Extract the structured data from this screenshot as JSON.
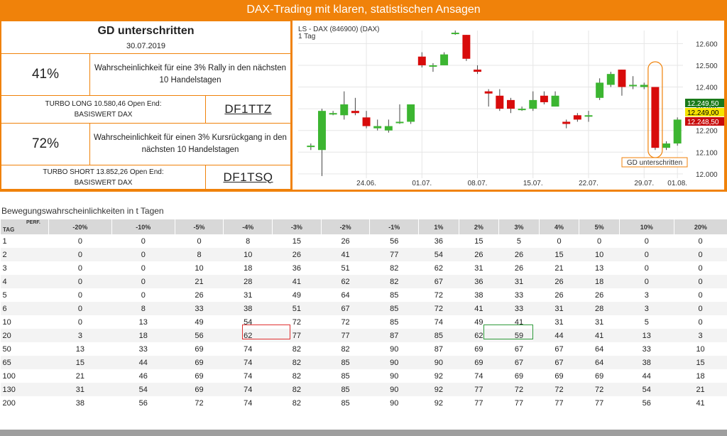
{
  "banner": "DAX-Trading mit klaren, statistischen Ansagen",
  "signal": {
    "title": "GD unterschritten",
    "date": "30.07.2019"
  },
  "long": {
    "pct": "41%",
    "desc": "Wahrscheinlichkeit für eine 3% Rally in den nächsten 10 Handelstagen",
    "product_line1": "TURBO LONG 10.580,46 Open End:",
    "product_line2": "BASISWERT DAX",
    "code": "DF1TTZ"
  },
  "short": {
    "pct": "72%",
    "desc": "Wahrscheinlichkeit für einen 3% Kursrückgang in den nächsten 10 Handelstagen",
    "product_line1": "TURBO SHORT 13.852,26 Open End:",
    "product_line2": "BASISWERT DAX",
    "code": "DF1TSQ"
  },
  "chart": {
    "title_line1": "LS - DAX (846900) (DAX)",
    "title_line2": "1 Tag",
    "annotation": "GD unterschritten",
    "y_ticks": [
      "12.600",
      "12.500",
      "12.400",
      "12.300",
      "12.200",
      "12.100",
      "12.000"
    ],
    "x_ticks": [
      "24.06.",
      "01.07.",
      "08.07.",
      "15.07.",
      "22.07.",
      "29.07.",
      "01.08."
    ],
    "price_labels": [
      "12.249,50",
      "12.249,00",
      "12.248,50"
    ],
    "colors": {
      "up": "#3cb531",
      "down": "#d80b0b",
      "accent": "#f0820a"
    }
  },
  "chart_data": {
    "type": "candlestick",
    "x": [
      "20.06.",
      "21.06.",
      "24.06.",
      "25.06.",
      "26.06.",
      "27.06.",
      "28.06.",
      "01.07.",
      "02.07.",
      "03.07.",
      "04.07.",
      "05.07.",
      "08.07.",
      "09.07.",
      "10.07.",
      "11.07.",
      "12.07.",
      "15.07.",
      "16.07.",
      "17.07.",
      "18.07.",
      "19.07.",
      "22.07.",
      "23.07.",
      "24.07.",
      "25.07.",
      "26.07.",
      "29.07.",
      "30.07.",
      "31.07.",
      "01.08."
    ],
    "ylim": [
      11980,
      12660
    ],
    "candles": [
      {
        "open": 12130,
        "close": 12130,
        "high": 12140,
        "low": 12110
      },
      {
        "open": 12110,
        "close": 12290,
        "high": 12300,
        "low": 11990
      },
      {
        "open": 12280,
        "close": 12280,
        "high": 12290,
        "low": 12270
      },
      {
        "open": 12270,
        "close": 12320,
        "high": 12380,
        "low": 12250
      },
      {
        "open": 12290,
        "close": 12280,
        "high": 12350,
        "low": 12270
      },
      {
        "open": 12260,
        "close": 12220,
        "high": 12290,
        "low": 12210
      },
      {
        "open": 12210,
        "close": 12220,
        "high": 12250,
        "low": 12200
      },
      {
        "open": 12200,
        "close": 12220,
        "high": 12250,
        "low": 12190
      },
      {
        "open": 12240,
        "close": 12240,
        "high": 12320,
        "low": 12230
      },
      {
        "open": 12240,
        "close": 12320,
        "high": 12320,
        "low": 12230
      },
      {
        "open": 12540,
        "close": 12500,
        "high": 12560,
        "low": 12490
      },
      {
        "open": 12500,
        "close": 12500,
        "high": 12510,
        "low": 12470
      },
      {
        "open": 12500,
        "close": 12550,
        "high": 12560,
        "low": 12500
      },
      {
        "open": 12650,
        "close": 12650,
        "high": 12660,
        "low": 12640
      },
      {
        "open": 12640,
        "close": 12530,
        "high": 12640,
        "low": 12520
      },
      {
        "open": 12480,
        "close": 12470,
        "high": 12500,
        "low": 12460
      },
      {
        "open": 12380,
        "close": 12370,
        "high": 12390,
        "low": 12310
      },
      {
        "open": 12360,
        "close": 12300,
        "high": 12390,
        "low": 12290
      },
      {
        "open": 12340,
        "close": 12300,
        "high": 12350,
        "low": 12280
      },
      {
        "open": 12300,
        "close": 12300,
        "high": 12310,
        "low": 12290
      },
      {
        "open": 12300,
        "close": 12340,
        "high": 12380,
        "low": 12290
      },
      {
        "open": 12360,
        "close": 12330,
        "high": 12380,
        "low": 12320
      },
      {
        "open": 12310,
        "close": 12360,
        "high": 12380,
        "low": 12310
      },
      {
        "open": 12240,
        "close": 12230,
        "high": 12250,
        "low": 12210
      },
      {
        "open": 12270,
        "close": 12250,
        "high": 12280,
        "low": 12240
      },
      {
        "open": 12270,
        "close": 12270,
        "high": 12290,
        "low": 12240
      },
      {
        "open": 12350,
        "close": 12420,
        "high": 12440,
        "low": 12340
      },
      {
        "open": 12410,
        "close": 12460,
        "high": 12470,
        "low": 12400
      },
      {
        "open": 12480,
        "close": 12400,
        "high": 12480,
        "low": 12360
      },
      {
        "open": 12410,
        "close": 12410,
        "high": 12450,
        "low": 12390
      },
      {
        "open": 12400,
        "close": 12410,
        "high": 12420,
        "low": 12390
      },
      {
        "open": 12400,
        "close": 12120,
        "high": 12400,
        "low": 12110
      },
      {
        "open": 12120,
        "close": 12140,
        "high": 12150,
        "low": 12110
      },
      {
        "open": 12140,
        "close": 12250,
        "high": 12260,
        "low": 12130
      }
    ]
  },
  "table": {
    "section_title": "Bewegungswahrscheinlichkeiten in t Tagen",
    "corner_tag": "TAG",
    "corner_perf": "PERF.",
    "headers": [
      "-20%",
      "-10%",
      "-5%",
      "-4%",
      "-3%",
      "-2%",
      "-1%",
      "1%",
      "2%",
      "3%",
      "4%",
      "5%",
      "10%",
      "20%"
    ],
    "rows": [
      {
        "tag": "1",
        "vals": [
          "0",
          "0",
          "0",
          "8",
          "15",
          "26",
          "56",
          "36",
          "15",
          "5",
          "0",
          "0",
          "0",
          "0"
        ]
      },
      {
        "tag": "2",
        "vals": [
          "0",
          "0",
          "8",
          "10",
          "26",
          "41",
          "77",
          "54",
          "26",
          "26",
          "15",
          "10",
          "0",
          "0"
        ]
      },
      {
        "tag": "3",
        "vals": [
          "0",
          "0",
          "10",
          "18",
          "36",
          "51",
          "82",
          "62",
          "31",
          "26",
          "21",
          "13",
          "0",
          "0"
        ]
      },
      {
        "tag": "4",
        "vals": [
          "0",
          "0",
          "21",
          "28",
          "41",
          "62",
          "82",
          "67",
          "36",
          "31",
          "26",
          "18",
          "0",
          "0"
        ]
      },
      {
        "tag": "5",
        "vals": [
          "0",
          "0",
          "26",
          "31",
          "49",
          "64",
          "85",
          "72",
          "38",
          "33",
          "26",
          "26",
          "3",
          "0"
        ]
      },
      {
        "tag": "6",
        "vals": [
          "0",
          "8",
          "33",
          "38",
          "51",
          "67",
          "85",
          "72",
          "41",
          "33",
          "31",
          "28",
          "3",
          "0"
        ]
      },
      {
        "tag": "10",
        "vals": [
          "0",
          "13",
          "49",
          "54",
          "72",
          "72",
          "85",
          "74",
          "49",
          "41",
          "31",
          "31",
          "5",
          "0"
        ]
      },
      {
        "tag": "20",
        "vals": [
          "3",
          "18",
          "56",
          "62",
          "77",
          "77",
          "87",
          "85",
          "62",
          "59",
          "44",
          "41",
          "13",
          "3"
        ]
      },
      {
        "tag": "50",
        "vals": [
          "13",
          "33",
          "69",
          "74",
          "82",
          "82",
          "90",
          "87",
          "69",
          "67",
          "67",
          "64",
          "33",
          "10"
        ]
      },
      {
        "tag": "65",
        "vals": [
          "15",
          "44",
          "69",
          "74",
          "82",
          "85",
          "90",
          "90",
          "69",
          "67",
          "67",
          "64",
          "38",
          "15"
        ]
      },
      {
        "tag": "100",
        "vals": [
          "21",
          "46",
          "69",
          "74",
          "82",
          "85",
          "90",
          "92",
          "74",
          "69",
          "69",
          "69",
          "44",
          "18"
        ]
      },
      {
        "tag": "130",
        "vals": [
          "31",
          "54",
          "69",
          "74",
          "82",
          "85",
          "90",
          "92",
          "77",
          "72",
          "72",
          "72",
          "54",
          "21"
        ]
      },
      {
        "tag": "200",
        "vals": [
          "38",
          "56",
          "72",
          "74",
          "82",
          "85",
          "90",
          "92",
          "77",
          "77",
          "77",
          "77",
          "56",
          "41"
        ]
      }
    ]
  }
}
